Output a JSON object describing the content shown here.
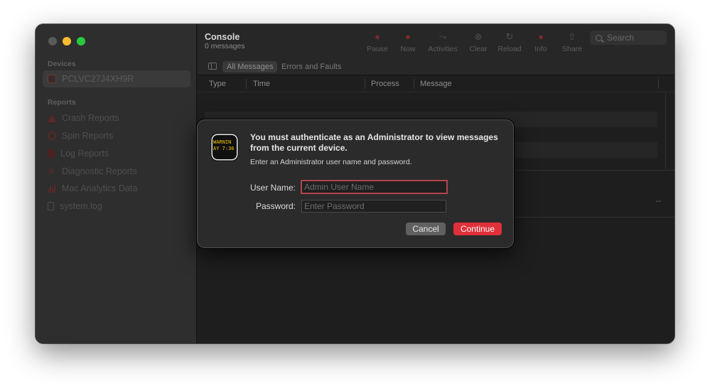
{
  "sidebar": {
    "devices_header": "Devices",
    "device_name": "PCLVC27J4XH9R",
    "reports_header": "Reports",
    "reports": [
      {
        "label": "Crash Reports",
        "icon": "warning-triangle-icon"
      },
      {
        "label": "Spin Reports",
        "icon": "spin-icon"
      },
      {
        "label": "Log Reports",
        "icon": "log-document-icon"
      },
      {
        "label": "Diagnostic Reports",
        "icon": "diagnostic-icon"
      },
      {
        "label": "Mac Analytics Data",
        "icon": "analytics-bars-icon"
      },
      {
        "label": "system.log",
        "icon": "document-icon"
      }
    ]
  },
  "toolbar": {
    "title": "Console",
    "subtitle": "0 messages",
    "buttons": {
      "pause": "Pause",
      "now": "Now",
      "activities": "Activities",
      "clear": "Clear",
      "reload": "Reload",
      "info": "Info",
      "share": "Share"
    },
    "search_placeholder": "Search"
  },
  "filter": {
    "all_messages": "All Messages",
    "errors_faults": "Errors and Faults"
  },
  "columns": {
    "type": "Type",
    "time": "Time",
    "process": "Process",
    "message": "Message"
  },
  "detail": {
    "dashes": "--"
  },
  "dialog": {
    "title": "You must authenticate as an Administrator to view messages from the current device.",
    "message": "Enter an Administrator user name and password.",
    "icon_lines": [
      "WARNIN",
      "AY 7:36"
    ],
    "username_label": "User Name:",
    "username_placeholder": "Admin User Name",
    "password_label": "Password:",
    "password_placeholder": "Enter Password",
    "cancel": "Cancel",
    "continue": "Continue"
  },
  "colors": {
    "accent": "#e0303a",
    "focus_ring": "#b0454c"
  }
}
